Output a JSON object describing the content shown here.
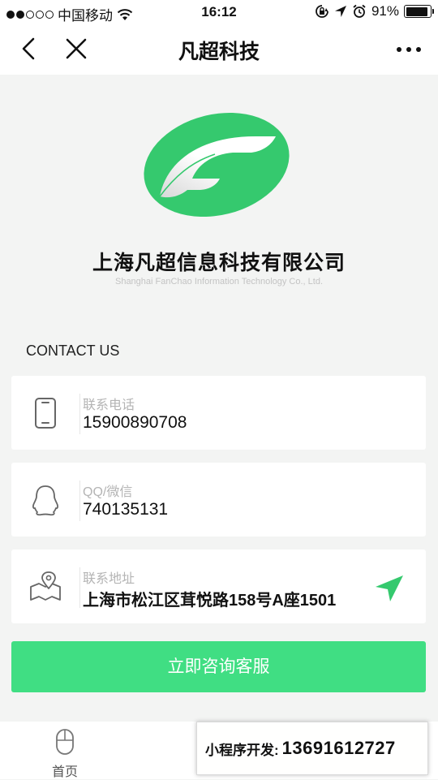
{
  "status_bar": {
    "carrier": "中国移动",
    "time": "16:12",
    "battery_percent": "91%",
    "battery_level": 0.91,
    "signal_bars_filled": 2,
    "signal_bars_total": 5,
    "icons": [
      "wifi-icon",
      "rotation-lock-icon",
      "location-arrow-icon",
      "alarm-icon",
      "battery-icon"
    ]
  },
  "navbar": {
    "title": "凡超科技",
    "icons": [
      "back-arrow-icon",
      "close-icon",
      "more-icon"
    ]
  },
  "company": {
    "name": "上海凡超信息科技有限公司",
    "name_en": "Shanghai FanChao Information Technology Co., Ltd."
  },
  "contact": {
    "section_title": "CONTACT US",
    "items": [
      {
        "label": "联系电话",
        "value": "15900890708",
        "icon": "phone-icon"
      },
      {
        "label": "QQ/微信",
        "value": "740135131",
        "icon": "qq-icon"
      },
      {
        "label": "联系地址",
        "value": "上海市松江区茸悦路158号A座1501",
        "icon": "map-location-icon",
        "action_icon": "navigate-icon"
      }
    ]
  },
  "cta": {
    "label": "立即咨询客服"
  },
  "tabbar": {
    "home_label": "首页",
    "home_icon": "mouse-icon"
  },
  "developer_banner": {
    "label": "小程序开发:",
    "phone": "13691612727"
  },
  "colors": {
    "accent_green": "#40de83",
    "logo_green": "#35c96e",
    "background": "#f3f4f3"
  }
}
